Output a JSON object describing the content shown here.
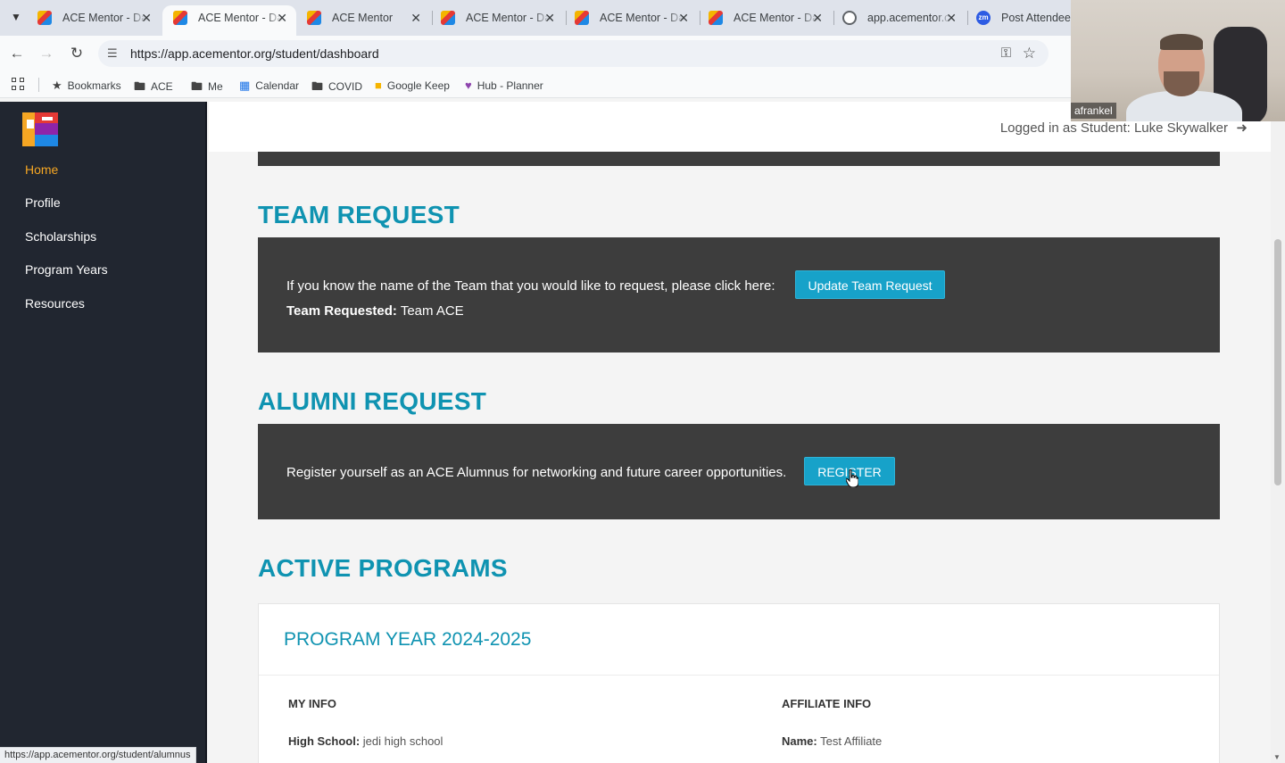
{
  "browser": {
    "tabs": [
      {
        "title": "ACE Mentor - Da",
        "icon": "ace-favicon",
        "active": false
      },
      {
        "title": "ACE Mentor - Da",
        "icon": "ace-favicon",
        "active": true
      },
      {
        "title": "ACE Mentor",
        "icon": "ace-favicon",
        "active": false
      },
      {
        "title": "ACE Mentor - Da",
        "icon": "ace-favicon",
        "active": false
      },
      {
        "title": "ACE Mentor - Da",
        "icon": "ace-favicon",
        "active": false
      },
      {
        "title": "ACE Mentor - Da",
        "icon": "ace-favicon",
        "active": false
      },
      {
        "title": "app.acementor.c",
        "icon": "globe-icon",
        "active": false
      },
      {
        "title": "Post Attendee -",
        "icon": "zoom-favicon",
        "active": false
      }
    ],
    "url": "https://app.acementor.org/student/dashboard",
    "bookmarks": [
      {
        "label": "Bookmarks",
        "icon": "star-icon"
      },
      {
        "label": "ACE",
        "icon": "folder-icon"
      },
      {
        "label": "Me",
        "icon": "folder-icon"
      },
      {
        "label": "Calendar",
        "icon": "calendar-icon"
      },
      {
        "label": "COVID",
        "icon": "folder-icon"
      },
      {
        "label": "Google Keep",
        "icon": "keep-icon"
      },
      {
        "label": "Hub - Planner",
        "icon": "hub-icon"
      }
    ],
    "status_url": "https://app.acementor.org/student/alumnus"
  },
  "video": {
    "participant_name": "afrankel"
  },
  "sidebar": {
    "items": [
      {
        "label": "Home",
        "active": true
      },
      {
        "label": "Profile",
        "active": false
      },
      {
        "label": "Scholarships",
        "active": false
      },
      {
        "label": "Program Years",
        "active": false
      },
      {
        "label": "Resources",
        "active": false
      }
    ]
  },
  "header": {
    "login_text": "Logged in as Student: Luke Skywalker"
  },
  "team_request": {
    "title": "TEAM REQUEST",
    "prompt": "If you know the name of the Team that you would like to request, please click here:",
    "button_label": "Update Team Request",
    "requested_label": "Team Requested:",
    "requested_value": "Team ACE"
  },
  "alumni_request": {
    "title": "ALUMNI REQUEST",
    "prompt": "Register yourself as an ACE Alumnus for networking and future career opportunities.",
    "button_label": "REGISTER"
  },
  "active_programs": {
    "title": "ACTIVE PROGRAMS",
    "program_year": "PROGRAM YEAR 2024-2025",
    "my_info_heading": "MY INFO",
    "affiliate_info_heading": "AFFILIATE INFO",
    "high_school_label": "High School:",
    "high_school_value": "jedi high school",
    "affiliate_name_label": "Name:",
    "affiliate_name_value": "Test Affiliate"
  },
  "colors": {
    "accent_teal": "#0f93b1",
    "button_teal": "#17a2c9",
    "sidebar_bg": "#212630",
    "active_nav": "#f5a623",
    "card_dark": "#3d3d3d"
  }
}
